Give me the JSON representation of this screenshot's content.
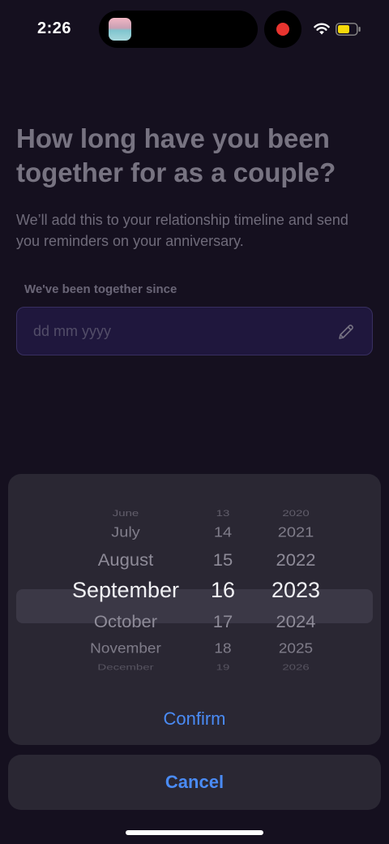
{
  "status_bar": {
    "time": "2:26"
  },
  "onboarding": {
    "headline": "How long have you been together for as a couple?",
    "subtitle": "We’ll add this to your relationship timeline and send you reminders on your anniversary.",
    "field_label": "We've been together since",
    "date_placeholder": "dd mm yyyy"
  },
  "picker": {
    "months": [
      "June",
      "July",
      "August",
      "September",
      "October",
      "November",
      "December"
    ],
    "days": [
      "13",
      "14",
      "15",
      "16",
      "17",
      "18",
      "19"
    ],
    "years": [
      "2020",
      "2021",
      "2022",
      "2023",
      "2024",
      "2025",
      "2026"
    ],
    "selected_month": "September",
    "selected_day": "16",
    "selected_year": "2023",
    "confirm_label": "Confirm",
    "cancel_label": "Cancel"
  },
  "colors": {
    "background": "#15101f",
    "accent": "#4a8bf5",
    "sheet": "#2a2733",
    "field": "#2a1f5c"
  },
  "icons": [
    "wifi-icon",
    "battery-icon",
    "pencil-icon",
    "record-indicator-icon"
  ]
}
